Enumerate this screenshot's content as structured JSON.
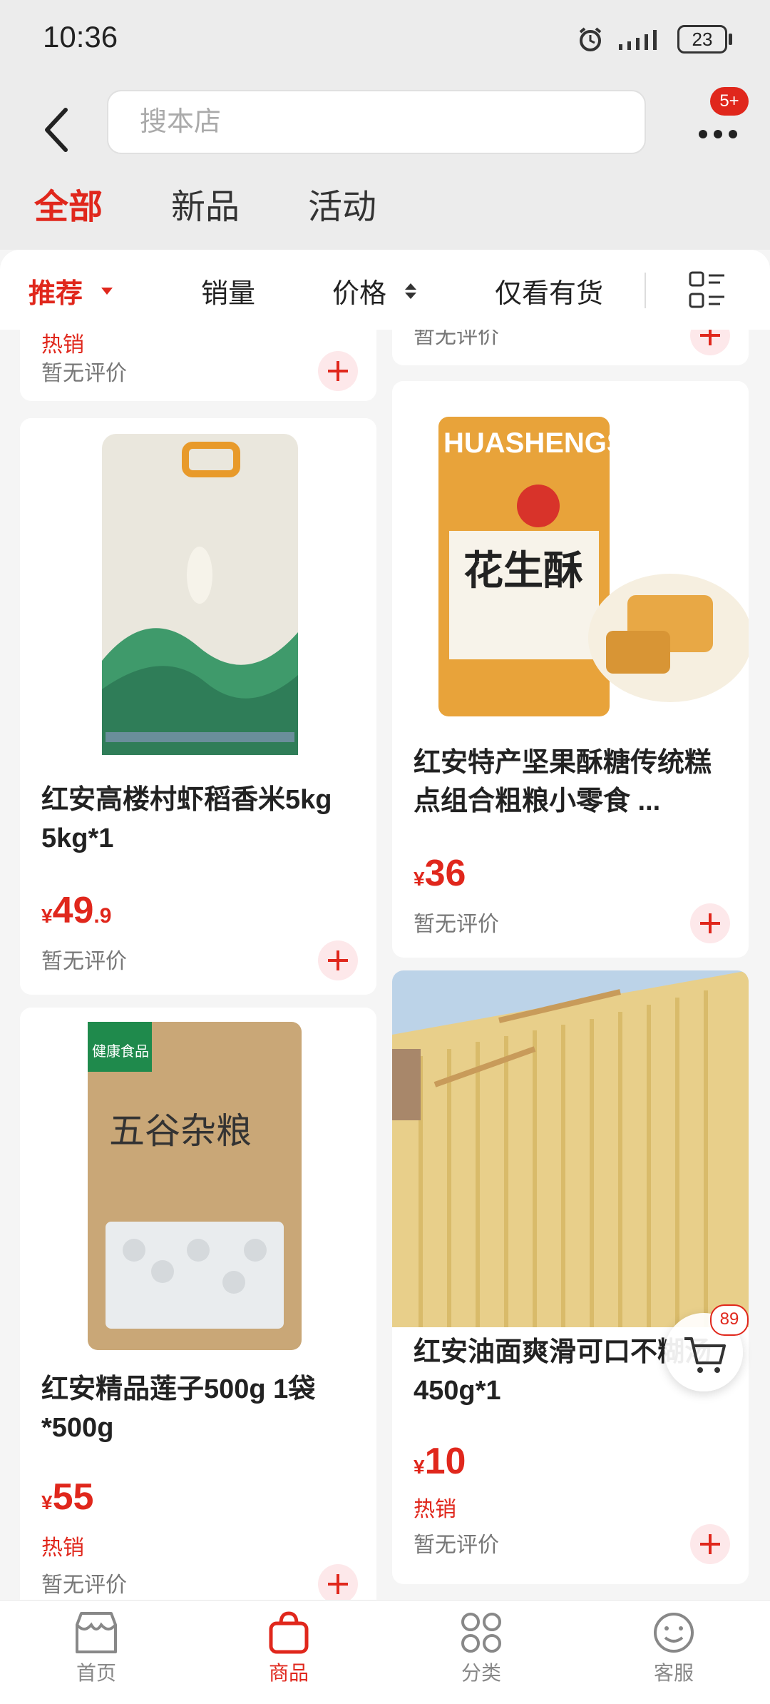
{
  "status_bar": {
    "time": "10:36",
    "battery": "23"
  },
  "header": {
    "search_placeholder": "搜本店",
    "more_badge": "5+",
    "tabs": [
      {
        "label": "全部",
        "active": true
      },
      {
        "label": "新品",
        "active": false
      },
      {
        "label": "活动",
        "active": false
      }
    ]
  },
  "filters": {
    "recommend": "推荐",
    "sales": "销量",
    "price": "价格",
    "in_stock": "仅看有货"
  },
  "top_partial": {
    "left_hot": "热销",
    "left_review": "暂无评价",
    "right_review": "暂无评价"
  },
  "products": [
    {
      "title": "红安高楼村虾稻香米5kg 5kg*1",
      "price_symbol": "¥",
      "price_int": "49",
      "price_dec": ".9",
      "hot": "",
      "review": "暂无评价",
      "image": "rice-bag"
    },
    {
      "title": "红安特产坚果酥糖传统糕点组合粗粮小零食 ...",
      "price_symbol": "¥",
      "price_int": "36",
      "price_dec": "",
      "hot": "",
      "review": "暂无评价",
      "image": "peanut-candy",
      "package_text": "HUASHENGSU",
      "package_label": "花生酥"
    },
    {
      "title": "红安精品莲子500g 1袋 *500g",
      "price_symbol": "¥",
      "price_int": "55",
      "price_dec": "",
      "hot": "热销",
      "review": "暂无评价",
      "image": "lotus-seed-bag",
      "package_text": "五谷杂粮",
      "package_tag": "健康食品"
    },
    {
      "title": "红安油面爽滑可口不糊汤 450g*1",
      "price_symbol": "¥",
      "price_int": "10",
      "price_dec": "",
      "hot": "热销",
      "review": "暂无评价",
      "image": "noodles-drying"
    }
  ],
  "float_cart": {
    "count": "89"
  },
  "bottom_nav": [
    {
      "label": "首页",
      "icon": "shop-icon",
      "active": false
    },
    {
      "label": "商品",
      "icon": "bag-icon",
      "active": true
    },
    {
      "label": "分类",
      "icon": "category-icon",
      "active": false
    },
    {
      "label": "客服",
      "icon": "service-icon",
      "active": false
    }
  ],
  "colors": {
    "accent": "#e0271c",
    "background": "#f5f5f5"
  }
}
